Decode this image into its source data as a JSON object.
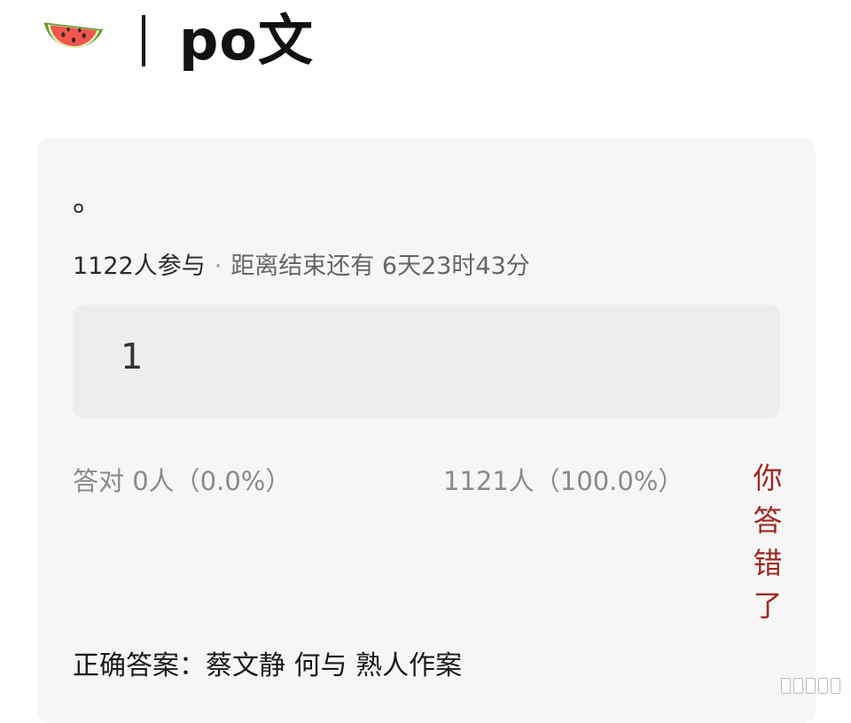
{
  "header": {
    "icon": "watermelon-icon",
    "title": "po文"
  },
  "poll": {
    "question": "。",
    "participants": "1122人参与",
    "separator": "·",
    "time_remaining": "距离结束还有 6天23时43分",
    "option": "1",
    "correct_stat": "答对  0人（0.0%）",
    "wrong_stat": "1121人（100.0%）",
    "result": "你答错了",
    "answer": "正确答案：蔡文静 何与 熟人作案"
  },
  "colors": {
    "card_bg": "#f6f6f6",
    "option_bg": "#ededed",
    "result_red": "#9c2a22",
    "muted_text": "#8a8a8a"
  }
}
